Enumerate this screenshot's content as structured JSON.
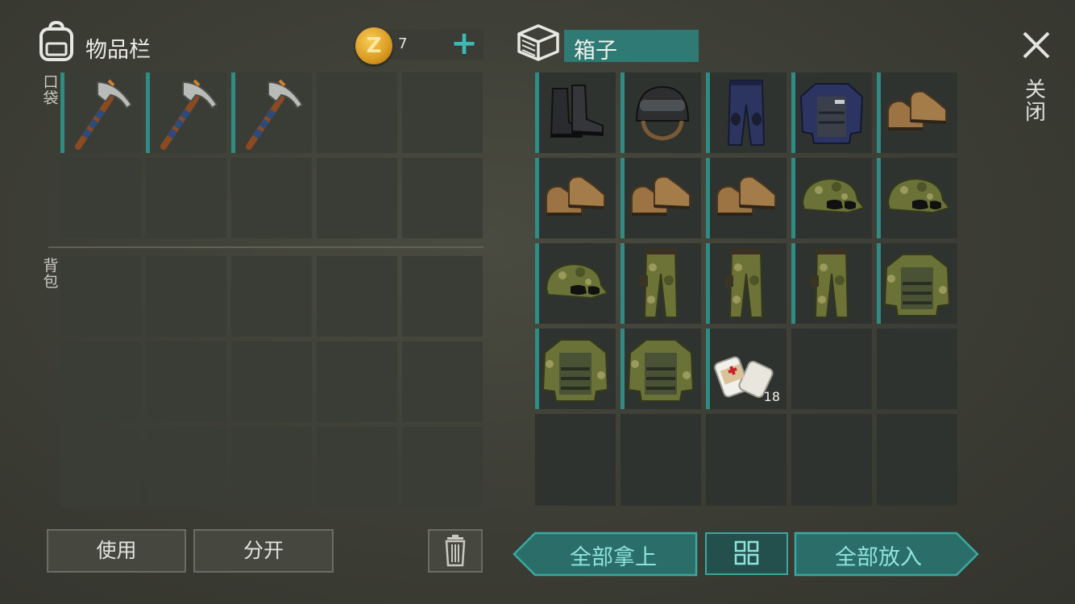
{
  "inventory": {
    "title": "物品栏",
    "pockets_label": "口袋",
    "backpack_label": "背包",
    "coin_symbol": "Z",
    "coin_count": "7",
    "add_symbol": "+",
    "pocket_slots": [
      {
        "item": "pickaxe",
        "icon": "pickaxe-icon"
      },
      {
        "item": "pickaxe",
        "icon": "pickaxe-icon"
      },
      {
        "item": "pickaxe",
        "icon": "pickaxe-icon"
      },
      {
        "item": "",
        "icon": ""
      },
      {
        "item": "",
        "icon": ""
      },
      {
        "item": "",
        "icon": ""
      },
      {
        "item": "",
        "icon": ""
      },
      {
        "item": "",
        "icon": ""
      },
      {
        "item": "",
        "icon": ""
      },
      {
        "item": "",
        "icon": ""
      }
    ],
    "backpack_slots": 15
  },
  "box": {
    "title": "箱子",
    "slots": [
      {
        "icon": "black-boots-icon"
      },
      {
        "icon": "military-helmet-icon"
      },
      {
        "icon": "police-pants-icon"
      },
      {
        "icon": "police-vest-icon"
      },
      {
        "icon": "tan-boots-icon"
      },
      {
        "icon": "tan-boots-icon"
      },
      {
        "icon": "tan-boots-icon"
      },
      {
        "icon": "tan-boots-icon"
      },
      {
        "icon": "camo-cap-icon"
      },
      {
        "icon": "camo-cap-icon"
      },
      {
        "icon": "camo-cap-icon"
      },
      {
        "icon": "camo-pants-icon"
      },
      {
        "icon": "camo-pants-icon"
      },
      {
        "icon": "camo-pants-icon"
      },
      {
        "icon": "camo-jacket-icon"
      },
      {
        "icon": "camo-jacket-icon"
      },
      {
        "icon": "camo-jacket-icon"
      },
      {
        "icon": "bandage-icon",
        "quantity": "18"
      }
    ]
  },
  "close_label": "关闭",
  "buttons": {
    "use": "使用",
    "split": "分开",
    "take_all": "全部拿上",
    "put_all": "全部放入"
  },
  "colors": {
    "accent_teal": "#2e8c85",
    "teal_text": "#8ee3dc",
    "coin_gold": "#e0a22a"
  }
}
